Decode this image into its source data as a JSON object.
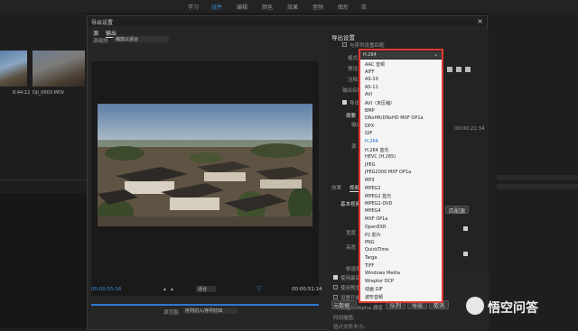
{
  "app": {
    "workspace_tabs": [
      "学习",
      "组件",
      "编辑",
      "颜色",
      "效果",
      "音频",
      "图形",
      "库"
    ],
    "active_tab_index": 1,
    "clip_name": "DJI_0003.MOV",
    "clip_duration": "6:44:12"
  },
  "dialog": {
    "title": "导出设置",
    "source_tab": "源",
    "output_tab": "输出",
    "source_scaling_label": "源缩放:",
    "source_scaling_value": "缩放以适合",
    "timecode_in": "00:00:55:16",
    "timecode_out": "00:00:51:14",
    "fit_value": "适合",
    "source_range_label": "源范围:",
    "source_range_value": "序列切入/序列切出"
  },
  "export_settings": {
    "title": "导出设置",
    "match_sequence_label": "与序列设置匹配",
    "format_label": "格式:",
    "format_value": "H.264",
    "preset_label": "预设:",
    "comment_label": "注释:",
    "output_name_label": "输出名称:",
    "export_video_label": "导出视频",
    "summary_label": "摘要",
    "summary_lines": [
      "输出",
      "源"
    ],
    "time_text": "00:00:21:34",
    "effects_tab": "效果",
    "video_tab": "视频",
    "basic_video_label": "基本视频设置",
    "match_source_button": "匹配源",
    "width_label": "宽度",
    "height_label": "高度",
    "frame_rate_label": "帧速率"
  },
  "bottom_options": {
    "use_max_render_label": "使用最高渲染质量",
    "use_previews_label": "使用预览",
    "set_start_timecode_label": "设置开始时间码",
    "render_alpha_label": "仅渲染 Alpha 通道",
    "interpolation_label": "时间插值:",
    "file_size_label": "估计文件大小:",
    "metadata_button": "元数据...",
    "queue_button": "队列",
    "export_button": "导出",
    "cancel_button": "取消"
  },
  "format_list": {
    "items": [
      "AAC 音频",
      "AIFF",
      "AS-10",
      "AS-11",
      "AVI",
      "AVI（未压缩）",
      "BMP",
      "DNxHR/DNxHD MXF OP1a",
      "DPX",
      "GIF",
      "H.264",
      "H.264 蓝光",
      "HEVC (H.265)",
      "JPEG",
      "JPEG2000 MXF OP1a",
      "MP3",
      "MPEG2",
      "MPEG2 蓝光",
      "MPEG2-DVD",
      "MPEG4",
      "MXF OP1a",
      "OpenEXR",
      "P2 影片",
      "PNG",
      "QuickTime",
      "Targa",
      "TIFF",
      "Windows Media",
      "Wraptor DCP",
      "动画 GIF",
      "波形音频"
    ],
    "selected": "H.264"
  },
  "watermark": {
    "text": "悟空问答"
  }
}
